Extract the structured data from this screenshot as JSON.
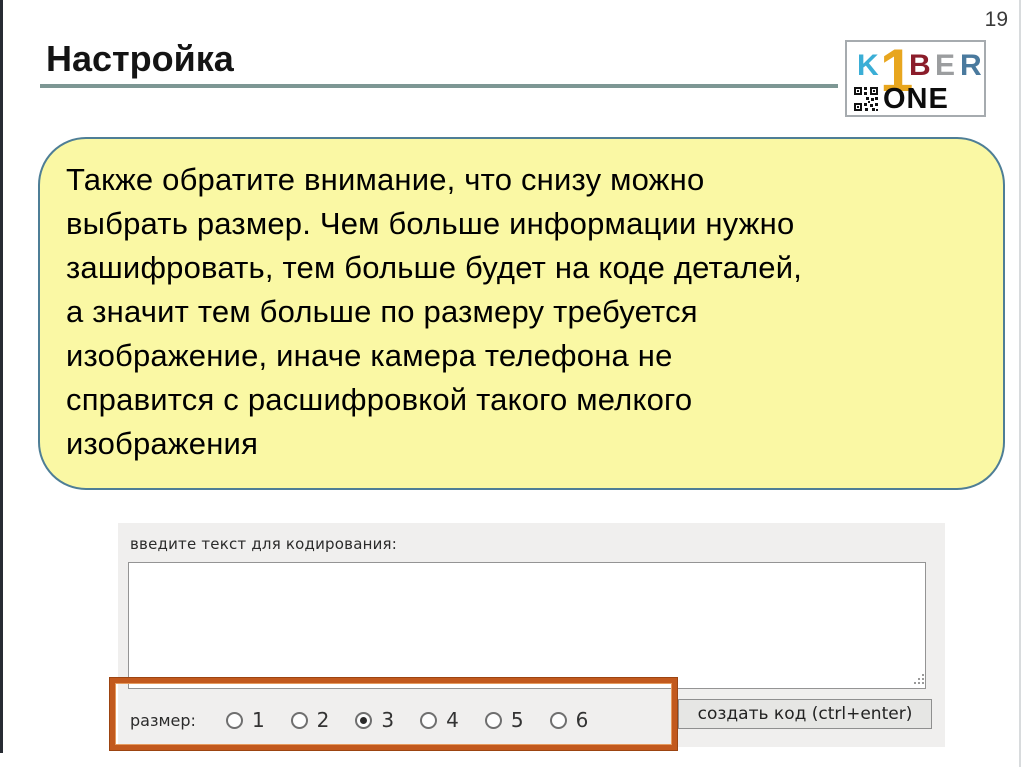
{
  "page": {
    "number": "19"
  },
  "header": {
    "title": "Настройка",
    "underline_color": "#7d9794"
  },
  "logo": {
    "name": "KIBER ONE",
    "letters": [
      {
        "char": "K",
        "color": "#3aaed6"
      },
      {
        "char": "1",
        "color": "#e8a61e"
      },
      {
        "char": "B",
        "color": "#8b1c2a"
      },
      {
        "char": "E",
        "color": "#9b9d9f"
      },
      {
        "char": "R",
        "color": "#4a7a9e"
      }
    ],
    "one_text": "ONE",
    "qr_icon": "qr-code-icon"
  },
  "callout": {
    "bg_color": "#faf8a4",
    "border_color": "#4e7e96",
    "text": "Также обратите внимание, что снизу можно\nвыбрать размер. Чем больше информации нужно\nзашифровать, тем больше будет на коде деталей,\nа значит тем больше по размеру требуется\nизображение, иначе камера телефона не\nсправится с расшифровкой такого мелкого\nизображения"
  },
  "form": {
    "label": "введите текст для кодирования:",
    "textarea_value": "",
    "size_label": "размер:",
    "size_options": [
      {
        "label": "1",
        "selected": false
      },
      {
        "label": "2",
        "selected": false
      },
      {
        "label": "3",
        "selected": true
      },
      {
        "label": "4",
        "selected": false
      },
      {
        "label": "5",
        "selected": false
      },
      {
        "label": "6",
        "selected": false
      }
    ],
    "button_label": "создать код (ctrl+enter)",
    "highlight_color": "#c2591d",
    "resize_grip_icon": "resize-grip-icon"
  }
}
